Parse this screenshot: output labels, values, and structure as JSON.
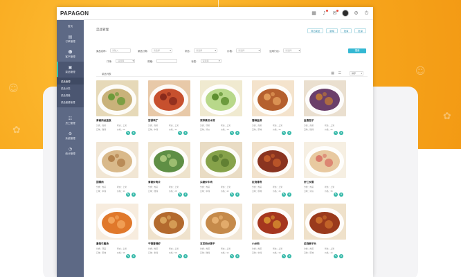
{
  "app": {
    "logo": "PAPAGON"
  },
  "topbar": {
    "icons": [
      "grid-icon",
      "bell-icon",
      "message-icon",
      "avatar",
      "settings-icon",
      "logout-icon"
    ]
  },
  "sidebar": {
    "items": [
      {
        "label": "首页",
        "icon": "home-icon"
      },
      {
        "label": "订单管理",
        "icon": "order-icon"
      },
      {
        "label": "客户管理",
        "icon": "customer-icon"
      },
      {
        "label": "菜品管理",
        "icon": "dish-icon",
        "active": true
      },
      {
        "label": "员工管理",
        "icon": "staff-icon"
      },
      {
        "label": "系统管理",
        "icon": "system-icon"
      },
      {
        "label": "统计管理",
        "icon": "stats-icon"
      }
    ],
    "subitems": [
      {
        "label": "菜品管理",
        "active": true
      },
      {
        "label": "菜品分类"
      },
      {
        "label": "菜品规格"
      },
      {
        "label": "菜品套餐管理"
      }
    ]
  },
  "main": {
    "page_title": "菜品管理",
    "actions": [
      "导出菜品",
      "新增",
      "批量",
      "批量"
    ],
    "filters_row1": [
      {
        "label": "菜品名称：",
        "placeholder": "请输入"
      },
      {
        "label": "菜品分类：",
        "placeholder": "请选择"
      },
      {
        "label": "状态：",
        "placeholder": "请选择"
      },
      {
        "label": "价格：",
        "placeholder": "请选择"
      },
      {
        "label": "适用门店：",
        "placeholder": "请选择"
      }
    ],
    "filters_row2": [
      {
        "label": "口味：",
        "placeholder": "请选择"
      },
      {
        "label": "规格：",
        "placeholder": ""
      },
      {
        "label": "标签：",
        "placeholder": "请选择"
      }
    ],
    "search_label": "搜索",
    "list_title": "菜品列表",
    "sort_label": "排序",
    "cards": [
      {
        "name": "青椒肉丝盖饭",
        "meta1": "分类：热菜",
        "meta2": "状态：上架",
        "meta3": "口味：微辣",
        "meta4": "价格：28"
      },
      {
        "name": "宫保鸡丁",
        "meta1": "分类：热菜",
        "meta2": "状态：上架",
        "meta3": "口味：中辣",
        "meta4": "价格：32"
      },
      {
        "name": "凉拌黄瓜木耳",
        "meta1": "分类：凉菜",
        "meta2": "状态：上架",
        "meta3": "口味：清淡",
        "meta4": "价格：18"
      },
      {
        "name": "香酥鱼排",
        "meta1": "分类：热菜",
        "meta2": "状态：上架",
        "meta3": "口味：原味",
        "meta4": "价格：36"
      },
      {
        "name": "鱼香茄子",
        "meta1": "分类：热菜",
        "meta2": "状态：上架",
        "meta3": "口味：微辣",
        "meta4": "价格：26"
      },
      {
        "name": "回锅肉",
        "meta1": "分类：热菜",
        "meta2": "状态：上架",
        "meta3": "口味：中辣",
        "meta4": "价格：30"
      },
      {
        "name": "青椒炒肉片",
        "meta1": "分类：热菜",
        "meta2": "状态：上架",
        "meta3": "口味：微辣",
        "meta4": "价格：28"
      },
      {
        "name": "尖椒炒牛肉",
        "meta1": "分类：热菜",
        "meta2": "状态：上架",
        "meta3": "口味：中辣",
        "meta4": "价格：42"
      },
      {
        "name": "红烧排骨",
        "meta1": "分类：热菜",
        "meta2": "状态：上架",
        "meta3": "口味：原味",
        "meta4": "价格：45"
      },
      {
        "name": "虾仁炒蛋",
        "meta1": "分类：热菜",
        "meta2": "状态：上架",
        "meta3": "口味：清淡",
        "meta4": "价格：35"
      },
      {
        "name": "番茄牛腩汤",
        "meta1": "分类：汤品",
        "meta2": "状态：上架",
        "meta3": "口味：原味",
        "meta4": "价格：38"
      },
      {
        "name": "干锅香辣虾",
        "meta1": "分类：热菜",
        "meta2": "状态：上架",
        "meta3": "口味：重辣",
        "meta4": "价格：58"
      },
      {
        "name": "五花肉炒香干",
        "meta1": "分类：热菜",
        "meta2": "状态：上架",
        "meta3": "口味：微辣",
        "meta4": "价格：32"
      },
      {
        "name": "小炒肉",
        "meta1": "分类：热菜",
        "meta2": "状态：上架",
        "meta3": "口味：中辣",
        "meta4": "价格：30"
      },
      {
        "name": "红烧狮子头",
        "meta1": "分类：热菜",
        "meta2": "状态：上架",
        "meta3": "口味：原味",
        "meta4": "价格：40"
      }
    ],
    "pager": [
      "<",
      "1",
      "2",
      "3",
      "4",
      "5",
      ">"
    ]
  },
  "colors": {
    "accent": "#34b8d3",
    "sidebar": "#5d6985",
    "op_button": "#34b8a8",
    "background": "#f7a21b"
  }
}
